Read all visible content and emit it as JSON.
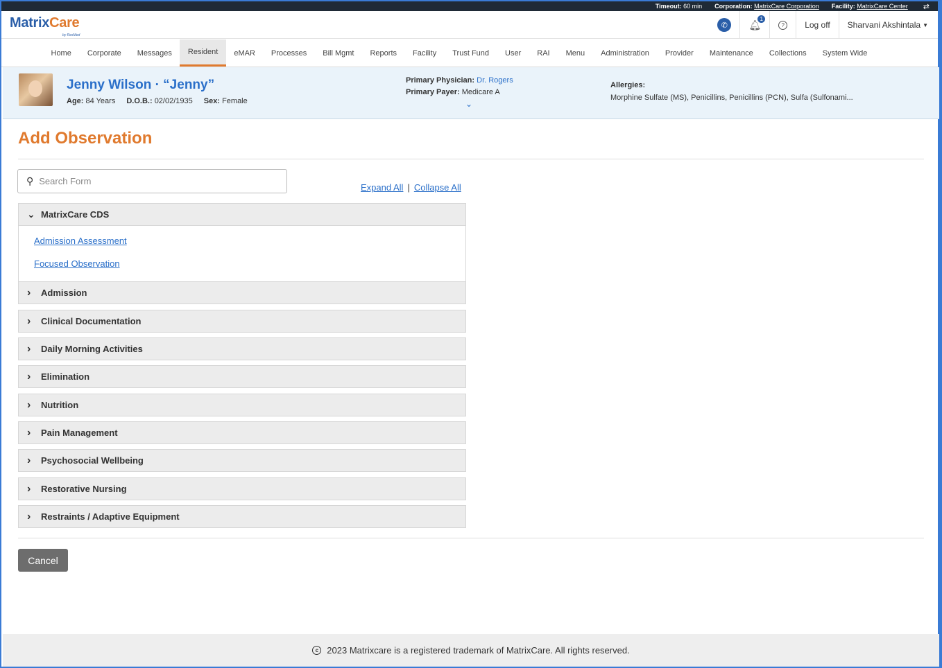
{
  "topbar": {
    "timeout_label": "Timeout:",
    "timeout_value": "60 min",
    "corporation_label": "Corporation:",
    "corporation_value": "MatrixCare Corporation",
    "facility_label": "Facility:",
    "facility_value": "MatrixCare Center"
  },
  "header": {
    "logo_matrix": "Matrix",
    "logo_care": "Care",
    "logo_sub": "by ResMed",
    "bell_count": "1",
    "logoff_label": "Log off",
    "user_name": "Sharvani Akshintala"
  },
  "nav": {
    "items": [
      "Home",
      "Corporate",
      "Messages",
      "Resident",
      "eMAR",
      "Processes",
      "Bill Mgmt",
      "Reports",
      "Facility",
      "Trust Fund",
      "User",
      "RAI",
      "Menu",
      "Administration",
      "Provider",
      "Maintenance",
      "Collections",
      "System Wide"
    ],
    "active": "Resident"
  },
  "resident": {
    "name": "Jenny Wilson · “Jenny”",
    "age_label": "Age:",
    "age_value": "84 Years",
    "dob_label": "D.O.B.:",
    "dob_value": "02/02/1935",
    "sex_label": "Sex:",
    "sex_value": "Female",
    "physician_label": "Primary Physician:",
    "physician_value": "Dr. Rogers",
    "payer_label": "Primary Payer:",
    "payer_value": "Medicare A",
    "allergies_label": "Allergies:",
    "allergies_value": "Morphine Sulfate (MS), Penicillins, Penicillins (PCN), Sulfa (Sulfonami..."
  },
  "main": {
    "title": "Add Observation",
    "search_placeholder": "Search Form",
    "expand_all": "Expand All",
    "collapse_all": "Collapse All",
    "sections": [
      {
        "label": "MatrixCare CDS",
        "expanded": true,
        "links": [
          "Admission Assessment",
          "Focused Observation"
        ]
      },
      {
        "label": "Admission"
      },
      {
        "label": "Clinical Documentation"
      },
      {
        "label": "Daily Morning Activities"
      },
      {
        "label": "Elimination"
      },
      {
        "label": "Nutrition"
      },
      {
        "label": "Pain Management"
      },
      {
        "label": "Psychosocial Wellbeing"
      },
      {
        "label": "Restorative Nursing"
      },
      {
        "label": "Restraints / Adaptive Equipment"
      }
    ],
    "cancel_label": "Cancel"
  },
  "footer": {
    "text": "2023 Matrixcare is a registered trademark of MatrixCare. All rights reserved."
  },
  "colors": {
    "accent_orange": "#e07a2e",
    "link_blue": "#2a6fc9",
    "brand_blue": "#2a5ea8"
  }
}
